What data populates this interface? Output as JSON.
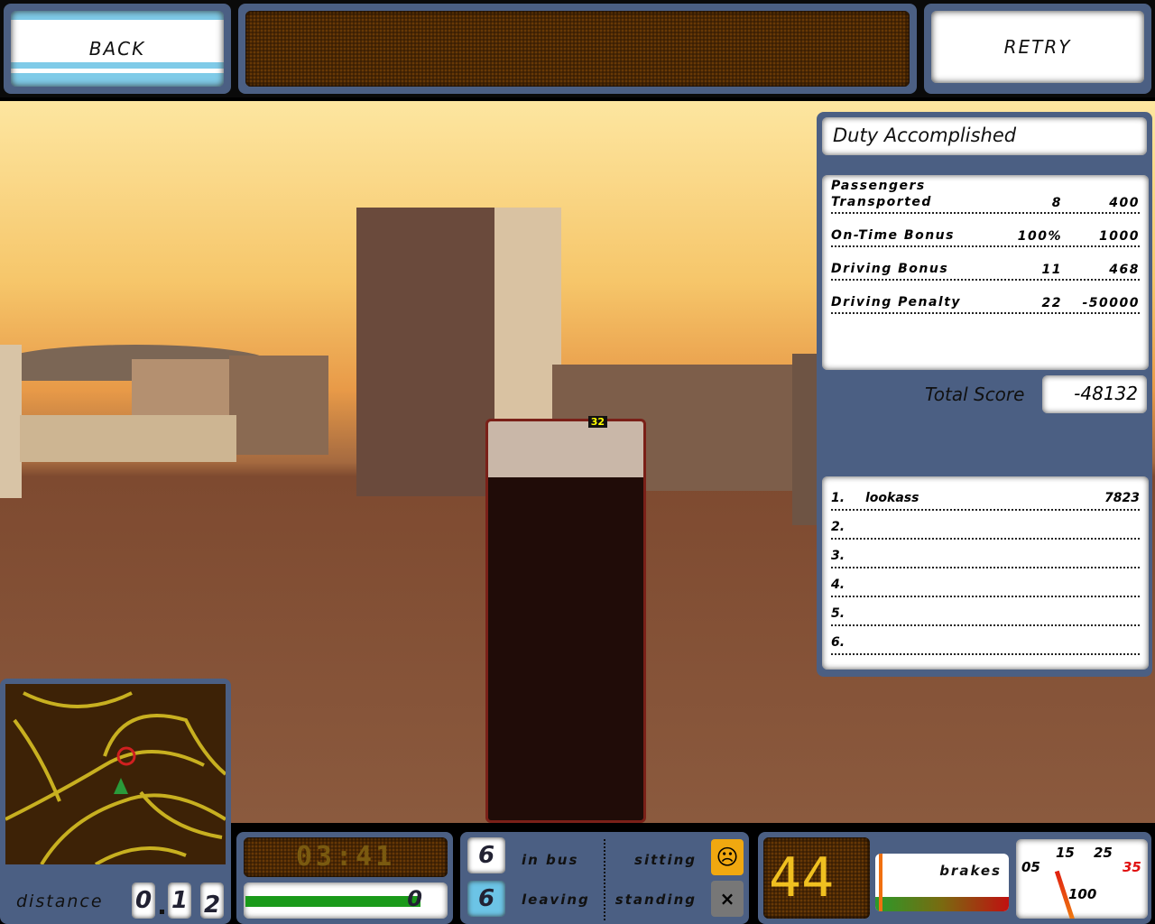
{
  "header": {
    "back_label": "BACK",
    "retry_label": "RETRY",
    "message": ""
  },
  "results": {
    "title": "Duty Accomplished",
    "rows": [
      {
        "label": "Passengers Transported",
        "count": "8",
        "points": "400"
      },
      {
        "label": "On-Time Bonus",
        "count": "100%",
        "points": "1000"
      },
      {
        "label": "Driving Bonus",
        "count": "11",
        "points": "468"
      },
      {
        "label": "Driving Penalty",
        "count": "22",
        "points": "-50000"
      }
    ],
    "total_label": "Total Score",
    "total_value": "-48132"
  },
  "leaderboard": [
    {
      "rank": "1.",
      "name": "lookass",
      "score": "7823"
    },
    {
      "rank": "2.",
      "name": "",
      "score": ""
    },
    {
      "rank": "3.",
      "name": "",
      "score": ""
    },
    {
      "rank": "4.",
      "name": "",
      "score": ""
    },
    {
      "rank": "5.",
      "name": "",
      "score": ""
    },
    {
      "rank": "6.",
      "name": "",
      "score": ""
    }
  ],
  "hud": {
    "distance_label": "distance",
    "distance_digits": [
      "0",
      "1",
      "2"
    ],
    "timer": "03:41",
    "delay_value": "0",
    "delay_progress": 0.88,
    "in_bus_count": "6",
    "in_bus_label": "in bus",
    "leaving_count": "6",
    "leaving_label": "leaving",
    "sitting_label": "sitting",
    "standing_label": "standing",
    "speed": "44",
    "brakes_label": "brakes",
    "gauge_labels": [
      "05",
      "15",
      "25",
      "35",
      "100"
    ],
    "bus_number": "32"
  },
  "colors": {
    "panel": "#4b5f83",
    "led": "#f0c020",
    "accent_blue": "#6cc4e6"
  }
}
